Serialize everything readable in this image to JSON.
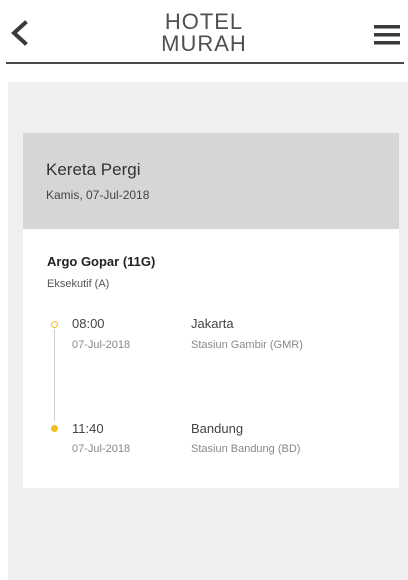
{
  "header": {
    "logo_line1": "HOTEL",
    "logo_line2": "MURAH"
  },
  "icons": {
    "back": "chevron-left-icon",
    "menu": "hamburger-menu-icon"
  },
  "trip": {
    "title": "Kereta Pergi",
    "date": "Kamis, 07-Jul-2018"
  },
  "train": {
    "name": "Argo Gopar (11G)",
    "class": "Eksekutif (A)"
  },
  "departure": {
    "time": "08:00",
    "date": "07-Jul-2018",
    "city": "Jakarta",
    "station": "Stasiun Gambir (GMR)"
  },
  "arrival": {
    "time": "11:40",
    "date": "07-Jul-2018",
    "city": "Bandung",
    "station": "Stasiun Bandung (BD)"
  },
  "colors": {
    "accent": "#f2c118",
    "header_band": "#d6d6d6",
    "page_bg": "#f0f0f0"
  }
}
